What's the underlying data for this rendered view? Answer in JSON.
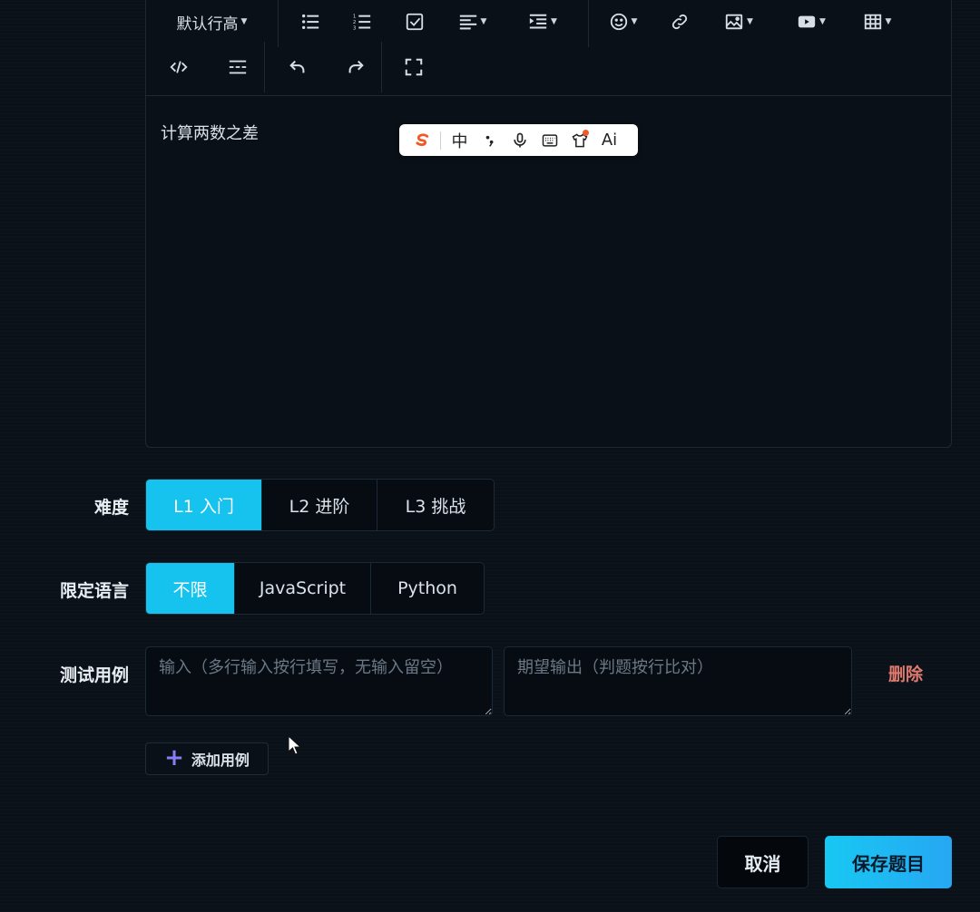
{
  "editor": {
    "toolbar": {
      "line_height_label": "默认行高"
    },
    "content": "计算两数之差"
  },
  "ime": {
    "chinese_label": "中",
    "ai_label": "Ai"
  },
  "form": {
    "difficulty": {
      "label": "难度",
      "options": [
        "L1 入门",
        "L2 进阶",
        "L3 挑战"
      ],
      "selected": "L1 入门"
    },
    "language": {
      "label": "限定语言",
      "options": [
        "不限",
        "JavaScript",
        "Python"
      ],
      "selected": "不限"
    },
    "test_cases": {
      "label": "测试用例",
      "input_placeholder": "输入（多行输入按行填写，无输入留空）",
      "input_value": "",
      "output_placeholder": "期望输出（判题按行比对）",
      "output_value": "",
      "delete_label": "删除",
      "add_label": "添加用例"
    }
  },
  "actions": {
    "cancel_label": "取消",
    "save_label": "保存题目"
  },
  "colors": {
    "accent": "#16c3ee",
    "danger": "#e07a6e",
    "background": "#0b1119"
  }
}
